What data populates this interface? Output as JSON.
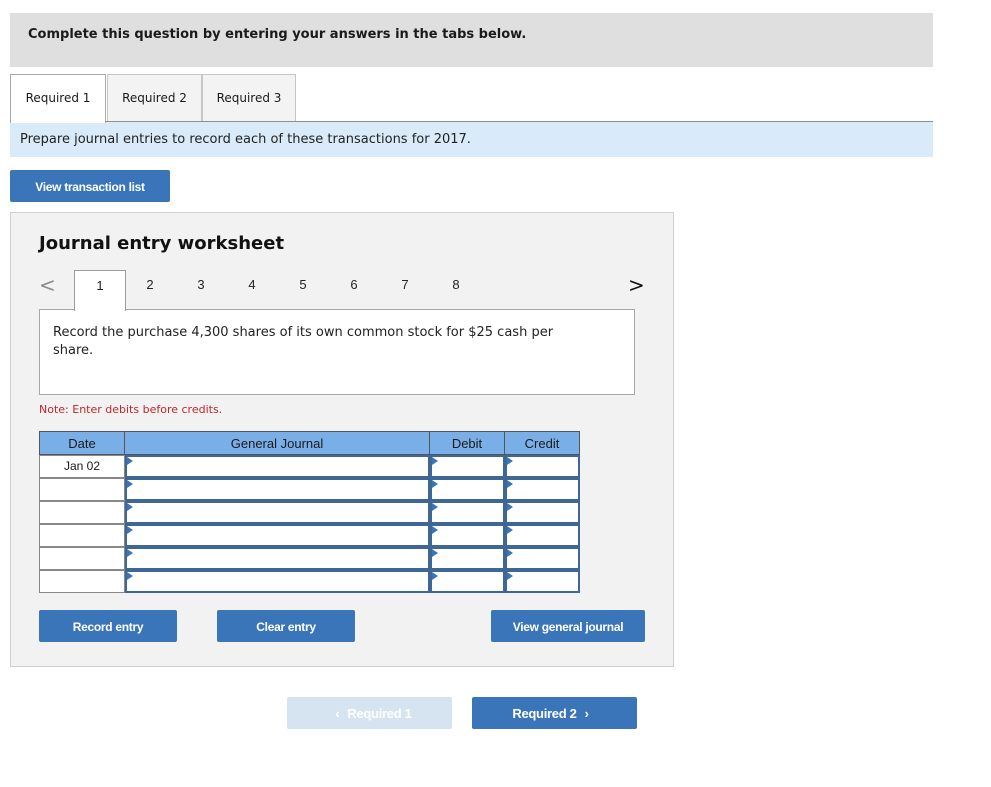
{
  "instruction": "Complete this question by entering your answers in the tabs below.",
  "tabs": [
    {
      "label": "Required 1",
      "active": true
    },
    {
      "label": "Required 2",
      "active": false
    },
    {
      "label": "Required 3",
      "active": false
    }
  ],
  "prompt": "Prepare journal entries to record each of these transactions for 2017.",
  "buttons": {
    "view_transaction_list": "View transaction list",
    "record_entry": "Record entry",
    "clear_entry": "Clear entry",
    "view_general_journal": "View general journal",
    "prev_required": "Required 1",
    "next_required": "Required 2"
  },
  "icons": {
    "prev": "‹",
    "next": "›",
    "pager_prev": "<",
    "pager_next": ">"
  },
  "worksheet": {
    "title": "Journal entry worksheet",
    "pages": [
      "1",
      "2",
      "3",
      "4",
      "5",
      "6",
      "7",
      "8"
    ],
    "active_page": "1",
    "description": "Record the purchase 4,300 shares of its own common stock for $25 cash per share.",
    "note": "Note: Enter debits before credits.",
    "table": {
      "headers": [
        "Date",
        "General Journal",
        "Debit",
        "Credit"
      ],
      "rows": [
        {
          "date": "Jan 02",
          "account": "",
          "debit": "",
          "credit": ""
        },
        {
          "date": "",
          "account": "",
          "debit": "",
          "credit": ""
        },
        {
          "date": "",
          "account": "",
          "debit": "",
          "credit": ""
        },
        {
          "date": "",
          "account": "",
          "debit": "",
          "credit": ""
        },
        {
          "date": "",
          "account": "",
          "debit": "",
          "credit": ""
        },
        {
          "date": "",
          "account": "",
          "debit": "",
          "credit": ""
        }
      ]
    }
  },
  "colors": {
    "primary_button": "#3a75b9",
    "disabled_button": "#d6e3f1",
    "table_header": "#7aaee6",
    "prompt_bg": "#d9ebf8",
    "note_text": "#c0272d"
  }
}
